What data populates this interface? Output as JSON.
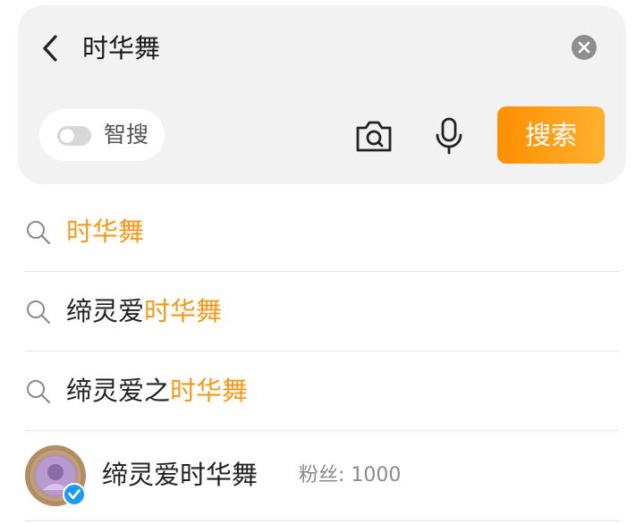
{
  "search": {
    "query": "时华舞",
    "smart_search_label": "智搜",
    "smart_search_enabled": false,
    "search_button_label": "搜索"
  },
  "colors": {
    "accent": "#ff9a1a",
    "highlight": "#f39a1d",
    "verified": "#1d9bf0"
  },
  "icons": [
    "back-icon",
    "clear-icon",
    "camera-icon",
    "microphone-icon",
    "search-icon",
    "verified-icon"
  ],
  "suggestions": [
    {
      "prefix": "",
      "highlight": "时华舞"
    },
    {
      "prefix": "缔灵爱",
      "highlight": "时华舞"
    },
    {
      "prefix": "缔灵爱之",
      "highlight": "时华舞"
    }
  ],
  "user_result": {
    "name": "缔灵爱时华舞",
    "fans_label": "粉丝:",
    "fans_count": "1000",
    "verified": true
  }
}
